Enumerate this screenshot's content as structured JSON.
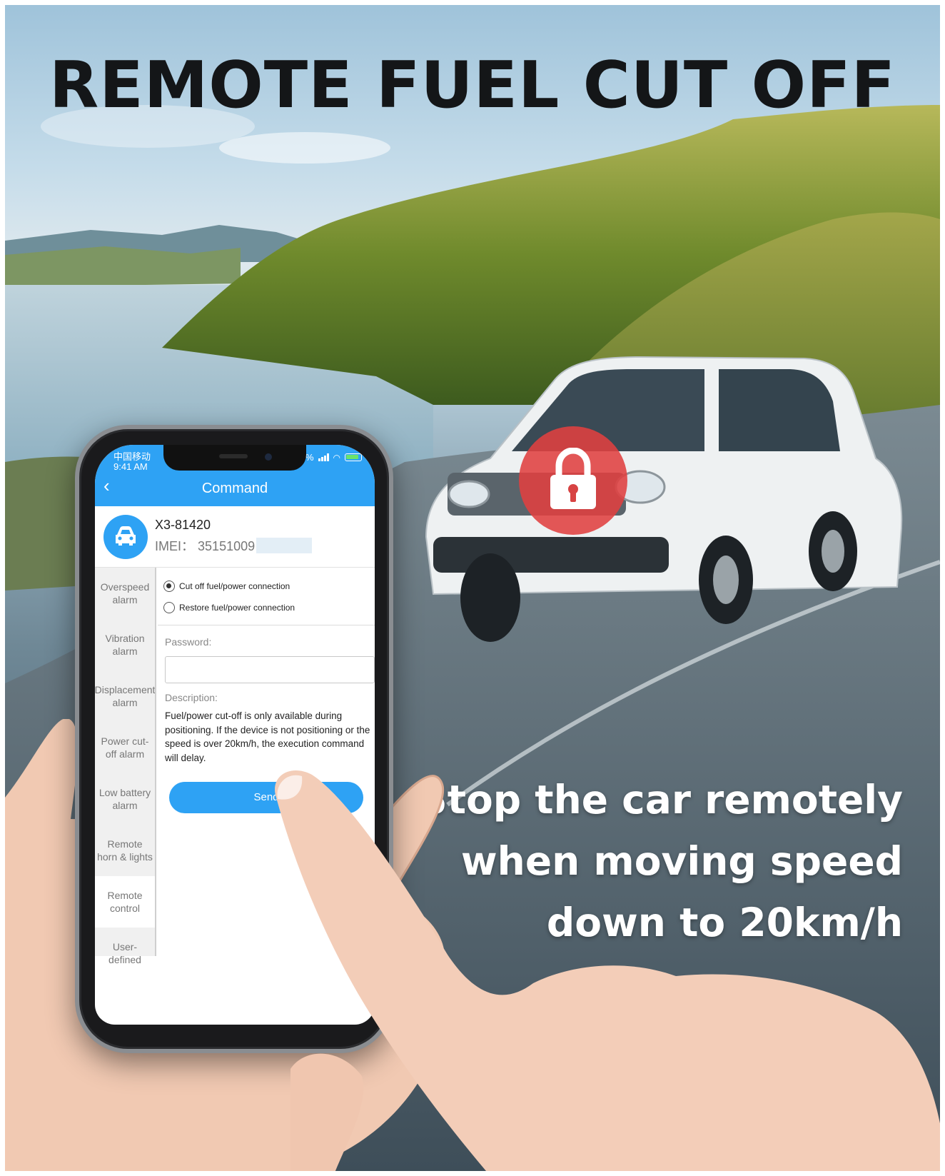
{
  "banner": {
    "headline": "REMOTE FUEL CUT OFF",
    "tagline": [
      "Stop the car remotely",
      "when moving speed",
      "down to 20km/h"
    ]
  },
  "status_bar": {
    "carrier": "中国移动",
    "time": "9:41 AM",
    "battery": "98%"
  },
  "header": {
    "title": "Command"
  },
  "device": {
    "name": "X3-81420",
    "imei_label": "IMEI：",
    "imei_value": "35151009"
  },
  "sidebar": {
    "items": [
      {
        "label": "Overspeed alarm"
      },
      {
        "label": "Vibration alarm"
      },
      {
        "label": "Displacement alarm"
      },
      {
        "label": "Power cut-off alarm"
      },
      {
        "label": "Low battery alarm"
      },
      {
        "label": "Remote horn & lights"
      },
      {
        "label": "Remote control"
      },
      {
        "label": "User-defined"
      }
    ]
  },
  "command": {
    "options": [
      {
        "label": "Cut off fuel/power connection",
        "selected": true
      },
      {
        "label": "Restore fuel/power connection",
        "selected": false
      }
    ],
    "password_label": "Password:",
    "password_value": "",
    "description_label": "Description:",
    "description_text": "Fuel/power cut-off is only available during positioning. If the device is not positioning or the speed is over 20km/h, the execution command will delay.",
    "send_label": "Send"
  },
  "colors": {
    "accent": "#2ea2f4",
    "lock_badge": "#e04040"
  },
  "icons": {
    "back": "chevron-left-icon",
    "avatar": "car-icon",
    "badge": "padlock-icon"
  }
}
